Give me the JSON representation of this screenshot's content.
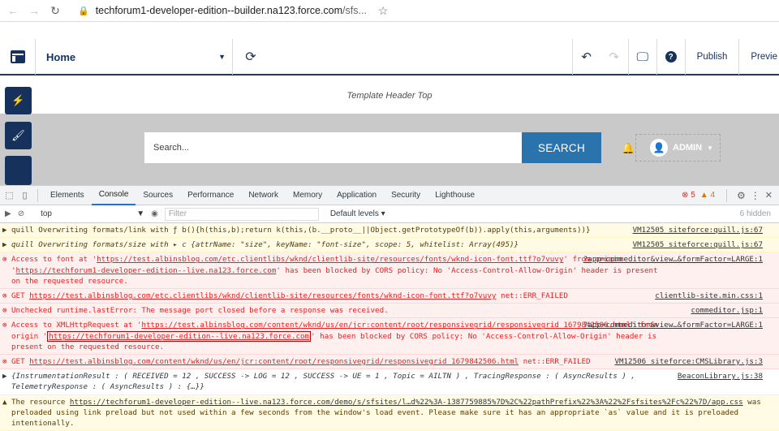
{
  "browser": {
    "url_main": "techforum1-developer-edition--builder.na123.force.com",
    "url_rest": "/sfs..."
  },
  "builder": {
    "page_name": "Home",
    "publish_label": "Publish",
    "preview_label": "Previe"
  },
  "site": {
    "template_header": "Template Header Top",
    "search_placeholder": "Search...",
    "search_button": "SEARCH",
    "user_label": "ADMIN"
  },
  "devtools": {
    "tabs": [
      "Elements",
      "Console",
      "Sources",
      "Performance",
      "Network",
      "Memory",
      "Application",
      "Security",
      "Lighthouse"
    ],
    "active_tab": "Console",
    "error_count": "5",
    "warning_count": "4",
    "context": "top",
    "filter_placeholder": "Filter",
    "levels_label": "Default levels ▾",
    "hidden_count": "6 hidden"
  },
  "console": [
    {
      "type": "warn",
      "text": "quill Overwriting formats/link with ƒ b(){h(this,b);return k(this,(b.__proto__||Object.getPrototypeOf(b)).apply(this,arguments))}",
      "source": "VM12505 siteforce:quill.js:67"
    },
    {
      "type": "warn",
      "text": "quill Overwriting formats/size with ▸ c {attrName: \"size\", keyName: \"font-size\", scope: 5, whitelist: Array(495)}",
      "source": "VM12505 siteforce:quill.js:67"
    },
    {
      "type": "err",
      "text_a": "Access to font at '",
      "link_a": "https://test.albinsblog.com/etc.clientlibs/wknd/clientlib-site/resources/fonts/wknd-icon-font.ttf?o7vuvy",
      "text_b": "' from origin '",
      "link_b": "https://techforum1-developer-edition--live.na123.force.com",
      "text_c": "' has been blocked by CORS policy: No 'Access-Control-Allow-Origin' header is present on the requested resource.",
      "source": "?app=commeditor&view…&formFactor=LARGE:1"
    },
    {
      "type": "err",
      "text_a": "GET ",
      "link_a": "https://test.albinsblog.com/etc.clientlibs/wknd/clientlib-site/resources/fonts/wknd-icon-font.ttf?o7vuvy",
      "text_b": " net::ERR_FAILED",
      "source": "clientlib-site.min.css:1"
    },
    {
      "type": "err",
      "text_a": "Unchecked runtime.lastError: The message port closed before a response was received.",
      "source": "commeditor.jsp:1"
    },
    {
      "type": "err",
      "text_a": "Access to XMLHttpRequest at '",
      "link_a": "https://test.albinsblog.com/content/wknd/us/en/jcr:content/root/responsivegrid/responsivegrid_1679842506.html",
      "text_b": "' from origin '",
      "link_b": "https://techforum1-developer-edition--live.na123.force.com",
      "text_c": "' has been blocked by CORS policy: No 'Access-Control-Allow-Origin' header is present on the requested resource.",
      "source": "?app=commeditor&view…&formFactor=LARGE:1"
    },
    {
      "type": "err",
      "text_a": "GET ",
      "link_a": "https://test.albinsblog.com/content/wknd/us/en/jcr:content/root/responsivegrid/responsivegrid_1679842506.html",
      "text_b": " net::ERR_FAILED",
      "source": "VM12506 siteforce:CMSLibrary.js:3"
    },
    {
      "type": "info",
      "text": "{InstrumentationResult :  ( RECEIVED = 12 , SUCCESS -> LOG = 12 , SUCCESS -> UE = 1 , Topic = AILTN )  , TracingResponse :  ( AsyncResults ) , TelemetryResponse :  ( AsyncResults ) :  {…}}",
      "source": "BeaconLibrary.js:38"
    },
    {
      "type": "warn",
      "text_a": "The resource ",
      "link_a": "https://techforum1-developer-edition--live.na123.force.com/demo/s/sfsites/l…d%22%3A-1387759885%7D%2C%22pathPrefix%22%3A%22%2Fsfsites%2Fc%22%7D/app.css",
      "text_b": " was preloaded using link preload but not used within a few seconds from the window's load event. Please make sure it has an appropriate `as` value and it is preloaded intentionally."
    }
  ]
}
